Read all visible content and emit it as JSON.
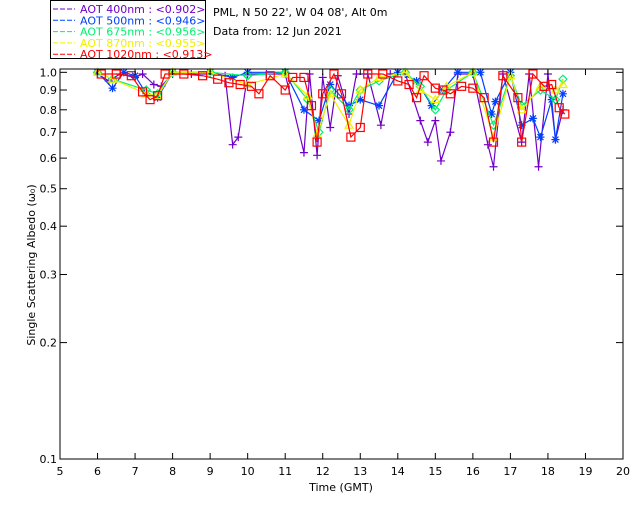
{
  "header": {
    "site": "PML, N 50 22', W 04 08', Alt 0m",
    "date": "Data from: 12 Jun 2021"
  },
  "legend": [
    {
      "label": "AOT  400nm : <0.902>",
      "color": "#7000c8"
    },
    {
      "label": "AOT  500nm : <0.946>",
      "color": "#0040ff"
    },
    {
      "label": "AOT  675nm : <0.956>",
      "color": "#00f070"
    },
    {
      "label": "AOT  870nm : <0.955>",
      "color": "#f0f000"
    },
    {
      "label": "AOT 1020nm : <0.913>",
      "color": "#ff0000"
    }
  ],
  "chart_data": {
    "type": "line",
    "xlabel": "Time (GMT)",
    "ylabel": "Single Scattering Albedo (ω₀)",
    "xlim": [
      5,
      20
    ],
    "ylim": [
      0.1,
      1.02
    ],
    "yscale": "log",
    "xticks": [
      "5",
      "6",
      "7",
      "8",
      "9",
      "10",
      "11",
      "12",
      "13",
      "14",
      "15",
      "16",
      "17",
      "18",
      "19",
      "20"
    ],
    "yticks": [
      "1.0",
      "0.9",
      "0.8",
      "0.7",
      "0.6",
      "0.5",
      "0.4",
      "0.3",
      "0.2",
      "0.1"
    ],
    "series": [
      {
        "name": "AOT 400nm",
        "color": "#7000c8",
        "marker": "plus",
        "points": [
          [
            6.0,
            0.99
          ],
          [
            6.3,
            0.95
          ],
          [
            6.6,
            0.99
          ],
          [
            7.0,
            0.97
          ],
          [
            7.2,
            0.99
          ],
          [
            7.5,
            0.93
          ],
          [
            7.7,
            0.92
          ],
          [
            8.0,
            0.99
          ],
          [
            8.5,
            0.99
          ],
          [
            9.0,
            0.99
          ],
          [
            9.4,
            0.98
          ],
          [
            9.6,
            0.65
          ],
          [
            9.75,
            0.68
          ],
          [
            10.0,
            0.99
          ],
          [
            10.5,
            0.99
          ],
          [
            11.0,
            0.99
          ],
          [
            11.5,
            0.62
          ],
          [
            11.65,
            0.99
          ],
          [
            11.85,
            0.61
          ],
          [
            12.0,
            0.97
          ],
          [
            12.2,
            0.72
          ],
          [
            12.4,
            0.98
          ],
          [
            12.7,
            0.78
          ],
          [
            12.9,
            0.99
          ],
          [
            13.2,
            0.99
          ],
          [
            13.55,
            0.73
          ],
          [
            13.8,
            0.99
          ],
          [
            14.2,
            0.99
          ],
          [
            14.6,
            0.75
          ],
          [
            14.8,
            0.66
          ],
          [
            15.0,
            0.75
          ],
          [
            15.15,
            0.59
          ],
          [
            15.4,
            0.7
          ],
          [
            15.6,
            0.99
          ],
          [
            16.0,
            0.99
          ],
          [
            16.4,
            0.65
          ],
          [
            16.55,
            0.57
          ],
          [
            16.8,
            0.99
          ],
          [
            17.3,
            0.66
          ],
          [
            17.5,
            0.99
          ],
          [
            17.75,
            0.57
          ],
          [
            18.0,
            0.99
          ],
          [
            18.2,
            0.67
          ],
          [
            18.4,
            0.8
          ]
        ]
      },
      {
        "name": "AOT 500nm",
        "color": "#0040ff",
        "marker": "star",
        "points": [
          [
            6.0,
            1.0
          ],
          [
            6.4,
            0.91
          ],
          [
            6.7,
            1.0
          ],
          [
            7.0,
            0.98
          ],
          [
            7.3,
            0.88
          ],
          [
            7.6,
            0.86
          ],
          [
            8.0,
            1.0
          ],
          [
            9.0,
            1.0
          ],
          [
            9.6,
            0.97
          ],
          [
            10.0,
            1.0
          ],
          [
            11.0,
            1.0
          ],
          [
            11.5,
            0.8
          ],
          [
            11.9,
            0.75
          ],
          [
            12.2,
            0.93
          ],
          [
            12.7,
            0.82
          ],
          [
            13.0,
            0.85
          ],
          [
            13.5,
            0.82
          ],
          [
            14.0,
            1.0
          ],
          [
            14.5,
            0.95
          ],
          [
            14.9,
            0.82
          ],
          [
            15.2,
            0.9
          ],
          [
            15.6,
            1.0
          ],
          [
            16.2,
            1.0
          ],
          [
            16.5,
            0.78
          ],
          [
            16.6,
            0.84
          ],
          [
            17.0,
            1.0
          ],
          [
            17.3,
            0.73
          ],
          [
            17.6,
            0.76
          ],
          [
            17.8,
            0.68
          ],
          [
            18.1,
            0.85
          ],
          [
            18.2,
            0.67
          ],
          [
            18.4,
            0.88
          ]
        ]
      },
      {
        "name": "AOT 675nm",
        "color": "#00f070",
        "marker": "diamond",
        "points": [
          [
            6.0,
            1.0
          ],
          [
            6.4,
            0.96
          ],
          [
            7.3,
            0.9
          ],
          [
            7.6,
            0.88
          ],
          [
            8.0,
            1.0
          ],
          [
            9.0,
            1.0
          ],
          [
            10.0,
            0.98
          ],
          [
            11.0,
            1.0
          ],
          [
            11.6,
            0.85
          ],
          [
            11.9,
            0.7
          ],
          [
            12.2,
            0.9
          ],
          [
            12.7,
            0.8
          ],
          [
            13.0,
            0.9
          ],
          [
            13.5,
            0.95
          ],
          [
            14.2,
            1.0
          ],
          [
            14.6,
            0.92
          ],
          [
            15.0,
            0.8
          ],
          [
            15.3,
            0.9
          ],
          [
            16.0,
            1.0
          ],
          [
            16.55,
            0.73
          ],
          [
            17.0,
            0.98
          ],
          [
            17.3,
            0.82
          ],
          [
            17.8,
            0.9
          ],
          [
            18.2,
            0.85
          ],
          [
            18.4,
            0.96
          ]
        ]
      },
      {
        "name": "AOT 870nm",
        "color": "#f0f000",
        "marker": "triangle",
        "points": [
          [
            6.0,
            1.0
          ],
          [
            6.4,
            0.96
          ],
          [
            7.3,
            0.88
          ],
          [
            7.6,
            0.87
          ],
          [
            8.0,
            1.0
          ],
          [
            9.0,
            1.0
          ],
          [
            10.0,
            0.93
          ],
          [
            11.0,
            0.99
          ],
          [
            11.6,
            0.87
          ],
          [
            11.85,
            0.69
          ],
          [
            12.2,
            0.88
          ],
          [
            12.7,
            0.73
          ],
          [
            13.0,
            0.9
          ],
          [
            13.5,
            0.97
          ],
          [
            14.2,
            1.0
          ],
          [
            14.6,
            0.9
          ],
          [
            15.0,
            0.85
          ],
          [
            15.3,
            0.92
          ],
          [
            16.0,
            1.0
          ],
          [
            16.55,
            0.68
          ],
          [
            17.0,
            0.98
          ],
          [
            17.3,
            0.8
          ],
          [
            17.8,
            0.92
          ],
          [
            18.2,
            0.9
          ],
          [
            18.4,
            0.93
          ]
        ]
      },
      {
        "name": "AOT 1020nm",
        "color": "#ff0000",
        "marker": "square",
        "points": [
          [
            6.1,
            0.99
          ],
          [
            6.5,
            0.99
          ],
          [
            6.9,
            0.98
          ],
          [
            7.2,
            0.89
          ],
          [
            7.4,
            0.85
          ],
          [
            7.6,
            0.87
          ],
          [
            7.8,
            0.99
          ],
          [
            8.3,
            0.99
          ],
          [
            8.8,
            0.98
          ],
          [
            9.2,
            0.96
          ],
          [
            9.5,
            0.94
          ],
          [
            9.8,
            0.93
          ],
          [
            10.1,
            0.92
          ],
          [
            10.3,
            0.88
          ],
          [
            10.6,
            0.98
          ],
          [
            11.0,
            0.9
          ],
          [
            11.2,
            0.97
          ],
          [
            11.5,
            0.97
          ],
          [
            11.7,
            0.82
          ],
          [
            11.85,
            0.66
          ],
          [
            12.0,
            0.88
          ],
          [
            12.3,
            0.99
          ],
          [
            12.5,
            0.88
          ],
          [
            12.75,
            0.68
          ],
          [
            13.0,
            0.72
          ],
          [
            13.2,
            0.99
          ],
          [
            13.6,
            0.99
          ],
          [
            14.0,
            0.95
          ],
          [
            14.3,
            0.93
          ],
          [
            14.5,
            0.86
          ],
          [
            14.7,
            0.98
          ],
          [
            15.0,
            0.91
          ],
          [
            15.2,
            0.9
          ],
          [
            15.4,
            0.88
          ],
          [
            15.7,
            0.92
          ],
          [
            16.0,
            0.91
          ],
          [
            16.3,
            0.86
          ],
          [
            16.55,
            0.66
          ],
          [
            16.8,
            0.98
          ],
          [
            17.2,
            0.86
          ],
          [
            17.3,
            0.66
          ],
          [
            17.6,
            0.99
          ],
          [
            17.9,
            0.92
          ],
          [
            18.1,
            0.93
          ],
          [
            18.3,
            0.81
          ],
          [
            18.45,
            0.78
          ]
        ]
      }
    ]
  }
}
